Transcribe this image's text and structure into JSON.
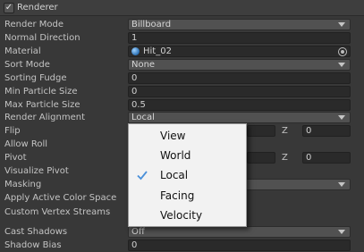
{
  "header": {
    "title": "Renderer",
    "enabled": true
  },
  "rows": {
    "render_mode": {
      "label": "Render Mode",
      "value": "Billboard"
    },
    "normal_direction": {
      "label": "Normal Direction",
      "value": "1"
    },
    "material": {
      "label": "Material",
      "value": "Hit_02"
    },
    "sort_mode": {
      "label": "Sort Mode",
      "value": "None"
    },
    "sorting_fudge": {
      "label": "Sorting Fudge",
      "value": "0"
    },
    "min_particle_size": {
      "label": "Min Particle Size",
      "value": "0"
    },
    "max_particle_size": {
      "label": "Max Particle Size",
      "value": "0.5"
    },
    "render_alignment": {
      "label": "Render Alignment",
      "value": "Local"
    },
    "flip": {
      "label": "Flip",
      "z_label": "Z",
      "z_value": "0"
    },
    "allow_roll": {
      "label": "Allow Roll"
    },
    "pivot": {
      "label": "Pivot",
      "z_label": "Z",
      "z_value": "0"
    },
    "visualize_pivot": {
      "label": "Visualize Pivot"
    },
    "masking": {
      "label": "Masking"
    },
    "apply_active_color_space": {
      "label": "Apply Active Color Space"
    },
    "custom_vertex_streams": {
      "label": "Custom Vertex Streams"
    },
    "cast_shadows": {
      "label": "Cast Shadows",
      "value": "Off"
    },
    "shadow_bias": {
      "label": "Shadow Bias",
      "value": "0"
    }
  },
  "dropdown": {
    "options": [
      "View",
      "World",
      "Local",
      "Facing",
      "Velocity"
    ],
    "selected": "Local",
    "check_color": "#4a90d9"
  }
}
